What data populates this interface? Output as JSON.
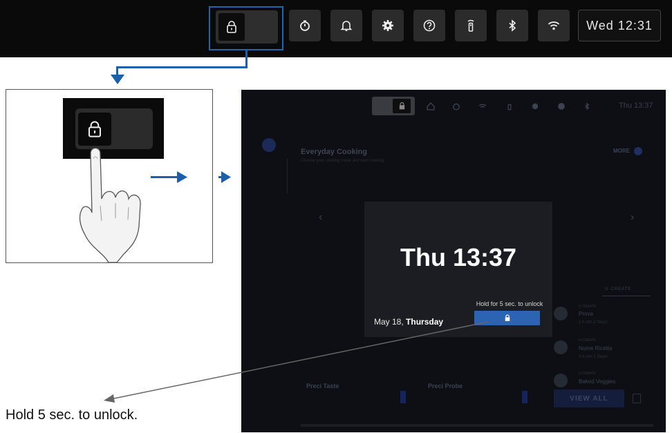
{
  "topbar": {
    "clock": "Wed 12:31",
    "icons": [
      "lock-icon",
      "timer-icon",
      "bell-icon",
      "gear-icon",
      "help-icon",
      "remote-icon",
      "bluetooth-icon",
      "wifi-icon"
    ]
  },
  "screen": {
    "clock": "Thu 13:37",
    "section_title": "Everyday Cooking",
    "section_subtitle": "Choose your cooking mode and start cooking",
    "more_label": "MORE",
    "tab_label": "U-CREATE",
    "recipes": [
      {
        "tag": "U-CREATE",
        "name": "Prova",
        "meta": "1 h  min   2 Steps"
      },
      {
        "tag": "U-CREATE",
        "name": "Nome Ricetta",
        "meta": "0 h  min   1 Steps"
      },
      {
        "tag": "U-CREATE",
        "name": "Baked Veggies",
        "meta": ""
      }
    ],
    "card_left_title": "Preci Taste",
    "card_right_title": "Preci Probe",
    "view_all": "VIEW ALL",
    "overlay": {
      "time": "Thu 13:37",
      "hold_hint": "Hold for 5 sec. to unlock",
      "date_prefix": "May 18, ",
      "weekday": "Thursday"
    }
  },
  "caption": "Hold 5 sec. to unlock.",
  "colors": {
    "accent": "#2a64b3",
    "arrow": "#1a5fa8",
    "screen_bg": "#0d0f14"
  }
}
